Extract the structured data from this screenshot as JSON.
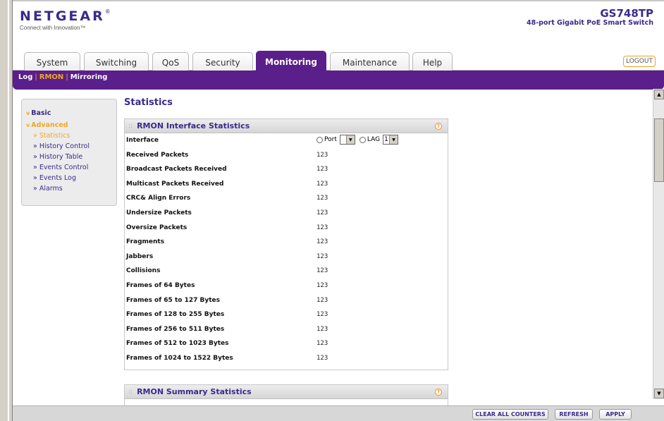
{
  "brand": {
    "logo": "NETGEAR",
    "reg_mark": "®",
    "tagline": "Connect with Innovation™"
  },
  "product": {
    "model": "GS748TP",
    "description": "48-port Gigabit PoE Smart Switch"
  },
  "tabs": [
    {
      "label": "System",
      "active": false
    },
    {
      "label": "Switching",
      "active": false
    },
    {
      "label": "QoS",
      "active": false
    },
    {
      "label": "Security",
      "active": false
    },
    {
      "label": "Monitoring",
      "active": true
    },
    {
      "label": "Maintenance",
      "active": false
    },
    {
      "label": "Help",
      "active": false
    }
  ],
  "logout_label": "LOGOUT",
  "subnav": {
    "items": [
      "Log",
      "RMON",
      "Mirroring"
    ],
    "selected": "RMON",
    "separator": "|"
  },
  "sidenav": {
    "sections": [
      {
        "label": "Basic",
        "arrow": "v",
        "open": false
      },
      {
        "label": "Advanced",
        "arrow": "v",
        "open": true
      }
    ],
    "items": [
      {
        "label": "» Statistics",
        "current": true
      },
      {
        "label": "» History Control",
        "current": false
      },
      {
        "label": "» History Table",
        "current": false
      },
      {
        "label": "» Events Control",
        "current": false
      },
      {
        "label": "» Events Log",
        "current": false
      },
      {
        "label": "» Alarms",
        "current": false
      }
    ]
  },
  "page_title": "Statistics",
  "interface_panel": {
    "title": "RMON Interface Statistics",
    "help_glyph": "?",
    "interface": {
      "label": "Interface",
      "port_label": "Port",
      "port_value": "",
      "lag_label": "LAG",
      "lag_value": "1",
      "dropdown_glyph": "▼"
    },
    "rows": [
      {
        "label": "Received Packets",
        "value": "123"
      },
      {
        "label": "Broadcast Packets Received",
        "value": "123"
      },
      {
        "label": "Multicast Packets Received",
        "value": "123"
      },
      {
        "label": "CRC& Align Errors",
        "value": "123"
      },
      {
        "label": "Undersize Packets",
        "value": "123"
      },
      {
        "label": "Oversize Packets",
        "value": "123"
      },
      {
        "label": "Fragments",
        "value": "123"
      },
      {
        "label": "Jabbers",
        "value": "123"
      },
      {
        "label": "Collisions",
        "value": "123"
      },
      {
        "label": "Frames of 64 Bytes",
        "value": "123"
      },
      {
        "label": "Frames of 65 to 127 Bytes",
        "value": "123"
      },
      {
        "label": "Frames of 128 to 255 Bytes",
        "value": "123"
      },
      {
        "label": "Frames of 256 to 511 Bytes",
        "value": "123"
      },
      {
        "label": "Frames of 512 to 1023 Bytes",
        "value": "123"
      },
      {
        "label": "Frames of 1024 to 1522 Bytes",
        "value": "123"
      }
    ]
  },
  "summary_panel": {
    "title": "RMON Summary Statistics",
    "help_glyph": "?"
  },
  "scrollbar": {
    "up_glyph": "▲",
    "down_glyph": "▼"
  },
  "buttons": {
    "clear": "CLEAR ALL COUNTERS",
    "refresh": "REFRESH",
    "apply": "APPLY"
  }
}
